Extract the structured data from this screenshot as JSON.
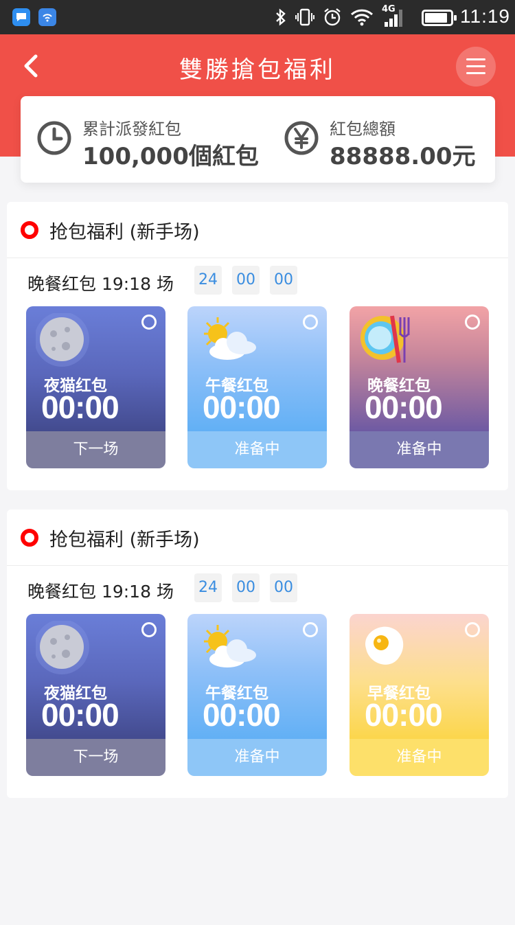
{
  "status_bar": {
    "time": "11:19",
    "network": "4G",
    "battery_level": 0.9
  },
  "header": {
    "title": "雙勝搶包福利"
  },
  "summary": {
    "distributed": {
      "label": "累計派發紅包",
      "value": "100,000個紅包"
    },
    "total": {
      "label": "紅包總額",
      "value": "88888.00元"
    }
  },
  "sections": [
    {
      "title": "抢包福利 (新手场)",
      "timer_label": "晚餐红包 19:18 场",
      "countdown": [
        "24",
        "00",
        "00"
      ],
      "cards": [
        {
          "name": "夜猫红包",
          "time": "00:00",
          "status": "下一场",
          "theme": "night",
          "icon": "moon-icon"
        },
        {
          "name": "午餐红包",
          "time": "00:00",
          "status": "准备中",
          "theme": "noon",
          "icon": "sun-cloud-icon"
        },
        {
          "name": "晚餐红包",
          "time": "00:00",
          "status": "准备中",
          "theme": "dinner",
          "icon": "plate-fork-icon"
        }
      ]
    },
    {
      "title": "抢包福利 (新手场)",
      "timer_label": "晚餐红包 19:18 场",
      "countdown": [
        "24",
        "00",
        "00"
      ],
      "cards": [
        {
          "name": "夜猫红包",
          "time": "00:00",
          "status": "下一场",
          "theme": "night",
          "icon": "moon-icon"
        },
        {
          "name": "午餐红包",
          "time": "00:00",
          "status": "准备中",
          "theme": "noon",
          "icon": "sun-cloud-icon"
        },
        {
          "name": "早餐红包",
          "time": "00:00",
          "status": "准备中",
          "theme": "morning",
          "icon": "fried-egg-icon"
        }
      ]
    }
  ],
  "colors": {
    "header": "#f05048",
    "accent_red": "#ff0000",
    "countdown_text": "#3a8de0"
  }
}
